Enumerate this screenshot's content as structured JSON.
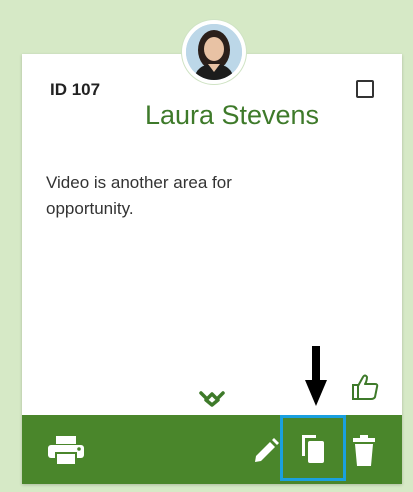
{
  "card": {
    "id_label": "ID 107",
    "name": "Laura Stevens",
    "text": "Video is another area for opportunity."
  },
  "icons": {
    "avatar": "avatar-photo",
    "checkbox": "checkbox-icon",
    "expand": "chevron-down-icon",
    "like": "thumbs-up-icon",
    "print": "print-icon",
    "edit": "pencil-icon",
    "copy": "copy-icon",
    "delete": "trash-icon",
    "pointer": "down-arrow-annotation"
  },
  "colors": {
    "accent": "#4a862b",
    "name": "#3e7a2a",
    "highlight": "#1aa0df",
    "background": "#d6e9c6"
  }
}
